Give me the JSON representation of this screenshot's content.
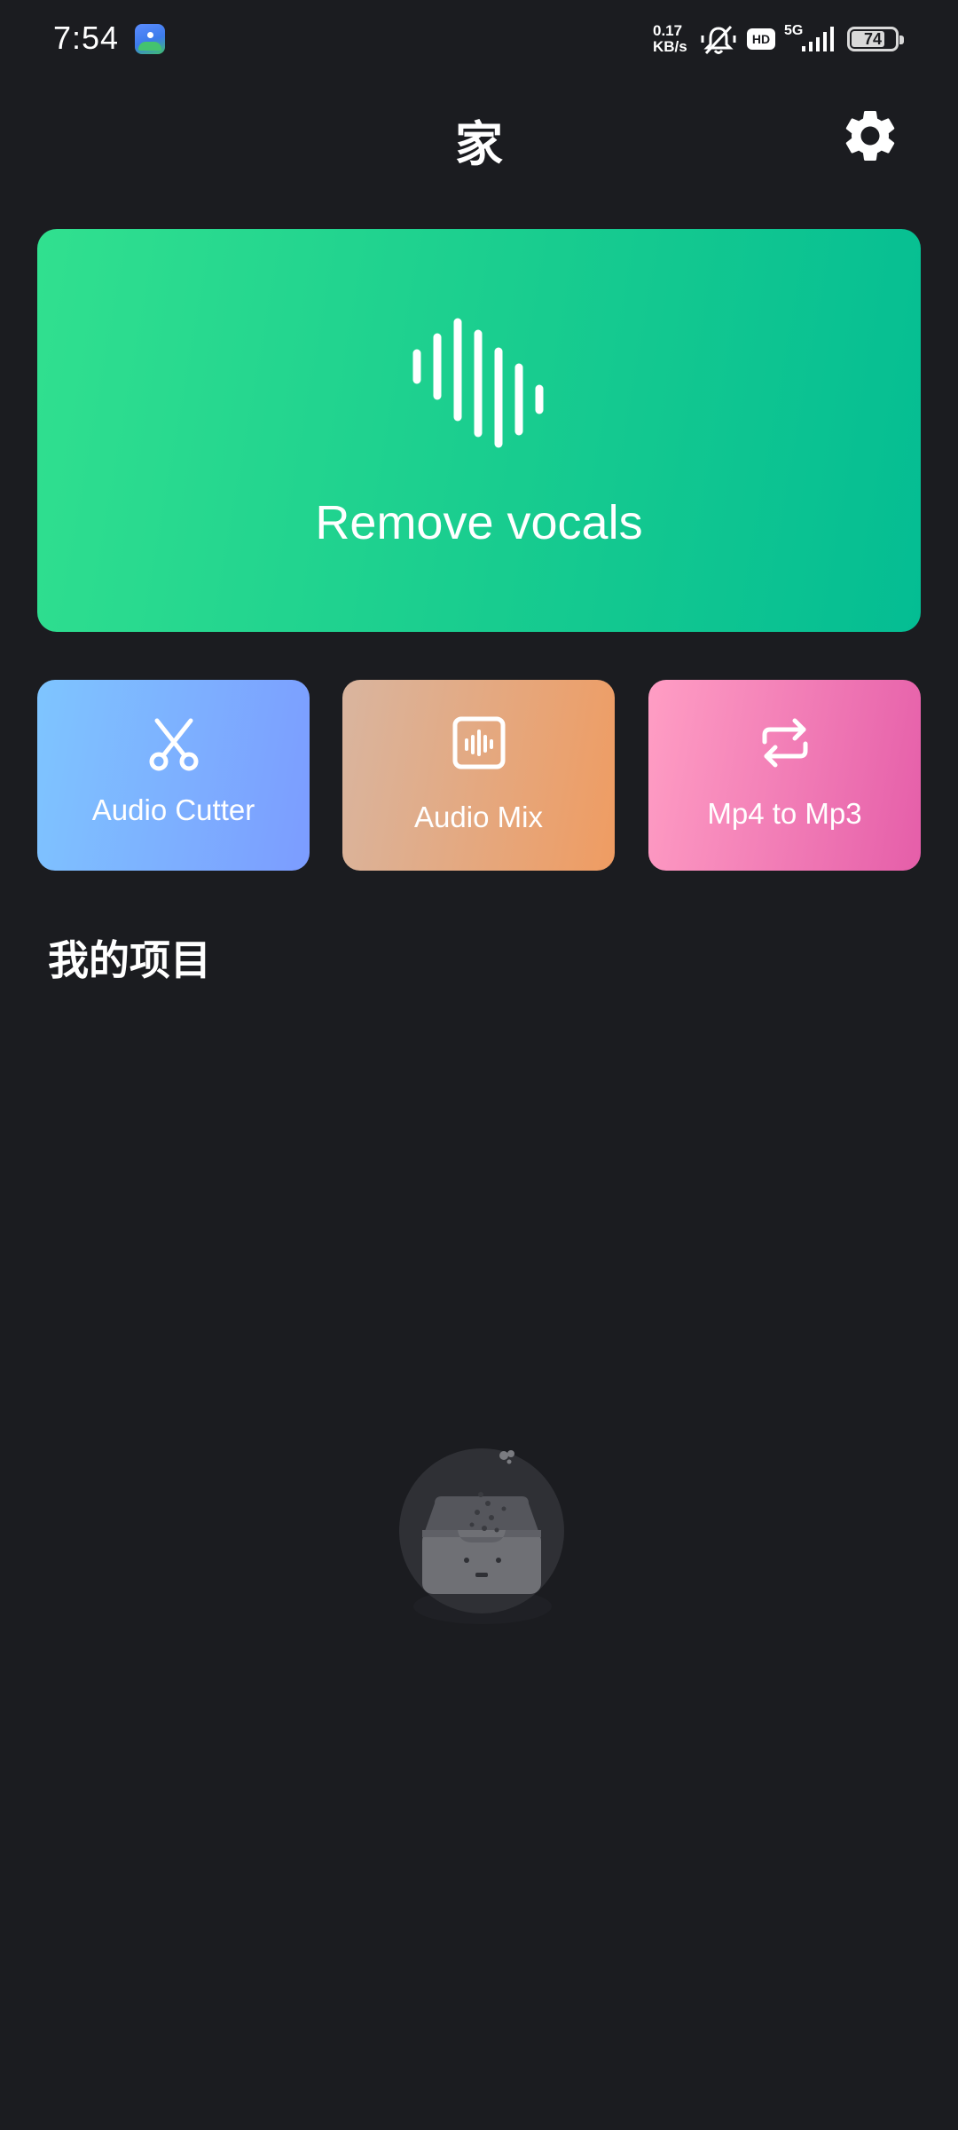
{
  "status_bar": {
    "time": "7:54",
    "net_speed_value": "0.17",
    "net_speed_unit": "KB/s",
    "hd_badge": "HD",
    "network_type": "5G",
    "battery_level": "74"
  },
  "header": {
    "title": "家"
  },
  "hero_card": {
    "label": "Remove vocals"
  },
  "tools": [
    {
      "label": "Audio Cutter",
      "icon": "scissors-icon"
    },
    {
      "label": "Audio Mix",
      "icon": "audio-wave-box-icon"
    },
    {
      "label": "Mp4 to Mp3",
      "icon": "convert-arrows-icon"
    }
  ],
  "projects": {
    "section_title": "我的项目"
  },
  "colors": {
    "background": "#1b1c20",
    "hero_start": "#31e08f",
    "hero_end": "#04bd93"
  }
}
